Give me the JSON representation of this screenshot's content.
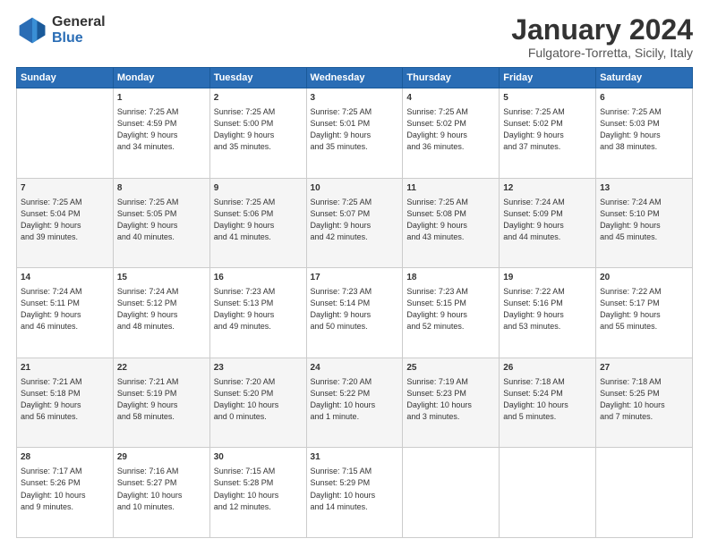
{
  "logo": {
    "general": "General",
    "blue": "Blue"
  },
  "header": {
    "title": "January 2024",
    "subtitle": "Fulgatore-Torretta, Sicily, Italy"
  },
  "columns": [
    "Sunday",
    "Monday",
    "Tuesday",
    "Wednesday",
    "Thursday",
    "Friday",
    "Saturday"
  ],
  "weeks": [
    [
      {
        "day": "",
        "content": ""
      },
      {
        "day": "1",
        "content": "Sunrise: 7:25 AM\nSunset: 4:59 PM\nDaylight: 9 hours\nand 34 minutes."
      },
      {
        "day": "2",
        "content": "Sunrise: 7:25 AM\nSunset: 5:00 PM\nDaylight: 9 hours\nand 35 minutes."
      },
      {
        "day": "3",
        "content": "Sunrise: 7:25 AM\nSunset: 5:01 PM\nDaylight: 9 hours\nand 35 minutes."
      },
      {
        "day": "4",
        "content": "Sunrise: 7:25 AM\nSunset: 5:02 PM\nDaylight: 9 hours\nand 36 minutes."
      },
      {
        "day": "5",
        "content": "Sunrise: 7:25 AM\nSunset: 5:02 PM\nDaylight: 9 hours\nand 37 minutes."
      },
      {
        "day": "6",
        "content": "Sunrise: 7:25 AM\nSunset: 5:03 PM\nDaylight: 9 hours\nand 38 minutes."
      }
    ],
    [
      {
        "day": "7",
        "content": "Sunrise: 7:25 AM\nSunset: 5:04 PM\nDaylight: 9 hours\nand 39 minutes."
      },
      {
        "day": "8",
        "content": "Sunrise: 7:25 AM\nSunset: 5:05 PM\nDaylight: 9 hours\nand 40 minutes."
      },
      {
        "day": "9",
        "content": "Sunrise: 7:25 AM\nSunset: 5:06 PM\nDaylight: 9 hours\nand 41 minutes."
      },
      {
        "day": "10",
        "content": "Sunrise: 7:25 AM\nSunset: 5:07 PM\nDaylight: 9 hours\nand 42 minutes."
      },
      {
        "day": "11",
        "content": "Sunrise: 7:25 AM\nSunset: 5:08 PM\nDaylight: 9 hours\nand 43 minutes."
      },
      {
        "day": "12",
        "content": "Sunrise: 7:24 AM\nSunset: 5:09 PM\nDaylight: 9 hours\nand 44 minutes."
      },
      {
        "day": "13",
        "content": "Sunrise: 7:24 AM\nSunset: 5:10 PM\nDaylight: 9 hours\nand 45 minutes."
      }
    ],
    [
      {
        "day": "14",
        "content": "Sunrise: 7:24 AM\nSunset: 5:11 PM\nDaylight: 9 hours\nand 46 minutes."
      },
      {
        "day": "15",
        "content": "Sunrise: 7:24 AM\nSunset: 5:12 PM\nDaylight: 9 hours\nand 48 minutes."
      },
      {
        "day": "16",
        "content": "Sunrise: 7:23 AM\nSunset: 5:13 PM\nDaylight: 9 hours\nand 49 minutes."
      },
      {
        "day": "17",
        "content": "Sunrise: 7:23 AM\nSunset: 5:14 PM\nDaylight: 9 hours\nand 50 minutes."
      },
      {
        "day": "18",
        "content": "Sunrise: 7:23 AM\nSunset: 5:15 PM\nDaylight: 9 hours\nand 52 minutes."
      },
      {
        "day": "19",
        "content": "Sunrise: 7:22 AM\nSunset: 5:16 PM\nDaylight: 9 hours\nand 53 minutes."
      },
      {
        "day": "20",
        "content": "Sunrise: 7:22 AM\nSunset: 5:17 PM\nDaylight: 9 hours\nand 55 minutes."
      }
    ],
    [
      {
        "day": "21",
        "content": "Sunrise: 7:21 AM\nSunset: 5:18 PM\nDaylight: 9 hours\nand 56 minutes."
      },
      {
        "day": "22",
        "content": "Sunrise: 7:21 AM\nSunset: 5:19 PM\nDaylight: 9 hours\nand 58 minutes."
      },
      {
        "day": "23",
        "content": "Sunrise: 7:20 AM\nSunset: 5:20 PM\nDaylight: 10 hours\nand 0 minutes."
      },
      {
        "day": "24",
        "content": "Sunrise: 7:20 AM\nSunset: 5:22 PM\nDaylight: 10 hours\nand 1 minute."
      },
      {
        "day": "25",
        "content": "Sunrise: 7:19 AM\nSunset: 5:23 PM\nDaylight: 10 hours\nand 3 minutes."
      },
      {
        "day": "26",
        "content": "Sunrise: 7:18 AM\nSunset: 5:24 PM\nDaylight: 10 hours\nand 5 minutes."
      },
      {
        "day": "27",
        "content": "Sunrise: 7:18 AM\nSunset: 5:25 PM\nDaylight: 10 hours\nand 7 minutes."
      }
    ],
    [
      {
        "day": "28",
        "content": "Sunrise: 7:17 AM\nSunset: 5:26 PM\nDaylight: 10 hours\nand 9 minutes."
      },
      {
        "day": "29",
        "content": "Sunrise: 7:16 AM\nSunset: 5:27 PM\nDaylight: 10 hours\nand 10 minutes."
      },
      {
        "day": "30",
        "content": "Sunrise: 7:15 AM\nSunset: 5:28 PM\nDaylight: 10 hours\nand 12 minutes."
      },
      {
        "day": "31",
        "content": "Sunrise: 7:15 AM\nSunset: 5:29 PM\nDaylight: 10 hours\nand 14 minutes."
      },
      {
        "day": "",
        "content": ""
      },
      {
        "day": "",
        "content": ""
      },
      {
        "day": "",
        "content": ""
      }
    ]
  ]
}
